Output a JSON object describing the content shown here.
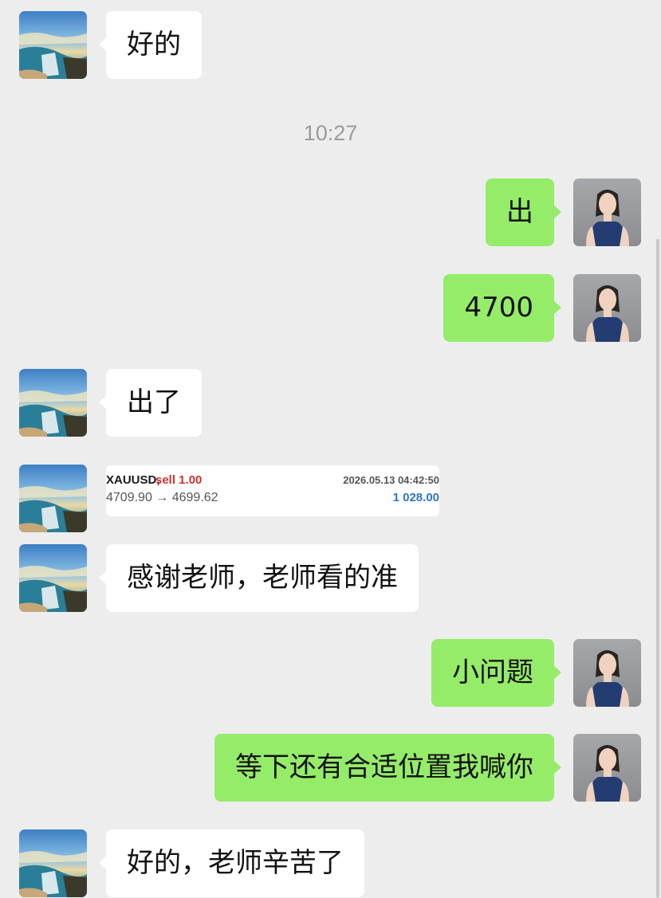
{
  "timestamp": "10:27",
  "messages": [
    {
      "side": "left",
      "text": "好的"
    },
    {
      "side": "right",
      "text": "出"
    },
    {
      "side": "right",
      "text": "4700"
    },
    {
      "side": "left",
      "text": "出了"
    },
    {
      "side": "left",
      "text": "感谢老师，老师看的准"
    },
    {
      "side": "right",
      "text": "小问题"
    },
    {
      "side": "right",
      "text": "等下还有合适位置我喊你"
    },
    {
      "side": "left",
      "text": "好的，老师辛苦了"
    }
  ],
  "trade_card": {
    "symbol": "XAUUSD,",
    "side": "sell 1.00",
    "time": "2026.05.13 04:42:50",
    "prices": "4709.90 → 4699.62",
    "profit": "1 028.00"
  },
  "colors": {
    "background": "#ededed",
    "own_bubble": "#95ec69",
    "other_bubble": "#ffffff",
    "sell": "#d0312d",
    "profit": "#2f73c9"
  },
  "icons": {
    "contact_avatar": "ocean-waterfall-avatar",
    "self_avatar": "woman-portrait-avatar"
  }
}
